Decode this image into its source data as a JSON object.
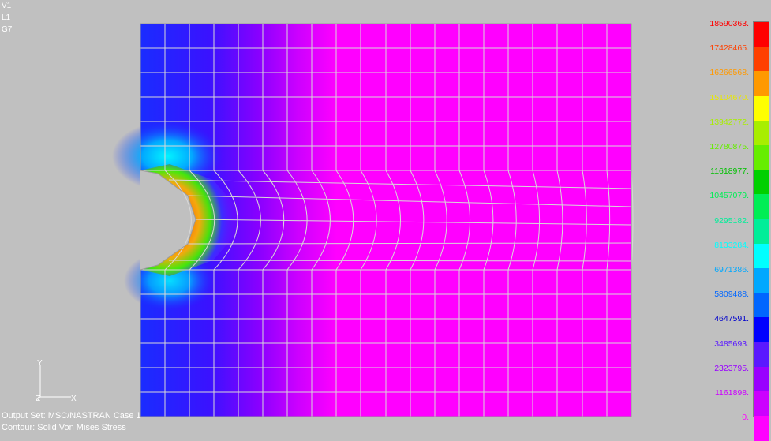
{
  "view": {
    "view_label": "V1",
    "layer_label": "L1",
    "group_label": "G7"
  },
  "status": {
    "output_set": "Output Set: MSC/NASTRAN Case 1",
    "contour": "Contour: Solid Von Mises Stress"
  },
  "triad": {
    "y_label": "Y",
    "z_label": "Z",
    "x_label": "X"
  },
  "legend": {
    "levels": [
      {
        "label": "18590363.",
        "color": "#ff0000"
      },
      {
        "label": "17428465.",
        "color": "#ff4000"
      },
      {
        "label": "16266568.",
        "color": "#ff9900"
      },
      {
        "label": "15104670.",
        "color": "#ffff00"
      },
      {
        "label": "13942772.",
        "color": "#a8ee00"
      },
      {
        "label": "12780875.",
        "color": "#66ee00"
      },
      {
        "label": "11618977.",
        "color": "#00d000"
      },
      {
        "label": "10457079.",
        "color": "#00ee55"
      },
      {
        "label": "9295182.",
        "color": "#00ee99"
      },
      {
        "label": "8133284.",
        "color": "#00ffff"
      },
      {
        "label": "6971386.",
        "color": "#00a8ff"
      },
      {
        "label": "5809488.",
        "color": "#0066ff"
      },
      {
        "label": "4647591.",
        "color": "#0000ff"
      },
      {
        "label": "3485693.",
        "color": "#5a18ff"
      },
      {
        "label": "2323795.",
        "color": "#9900ff"
      },
      {
        "label": "1161898.",
        "color": "#cc00ff"
      },
      {
        "label": "0.",
        "color": "#ff00ff"
      }
    ],
    "text_colors": [
      "#ff0000",
      "#ff4000",
      "#ff9900",
      "#e8e800",
      "#a8ee00",
      "#66ee00",
      "#00c000",
      "#00ee55",
      "#00ee99",
      "#00ffff",
      "#00a8ff",
      "#0066ff",
      "#0000cc",
      "#5a18ff",
      "#9900ff",
      "#cc00ff",
      "#ff00ff"
    ]
  },
  "colors": {
    "background": "#c0c0c0",
    "mesh_line": "#d8d8d8",
    "low_stress": "#ff00ff",
    "peak_stress": "#ff0000"
  }
}
